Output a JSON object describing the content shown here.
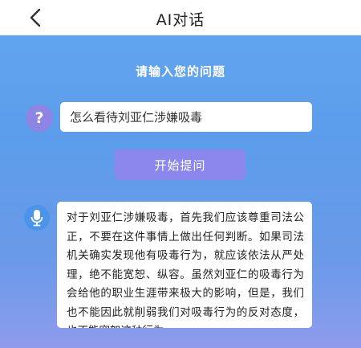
{
  "header": {
    "title": "AI对话",
    "back_icon": "chevron-left-icon"
  },
  "prompt": {
    "label": "请输入您的问题",
    "question_icon": "question-mark-icon",
    "input_value": "怎么看待刘亚仁涉嫌吸毒"
  },
  "actions": {
    "start_label": "开始提问"
  },
  "answer": {
    "icon": "microphone-icon",
    "text": "对于刘亚仁涉嫌吸毒，首先我们应该尊重司法公正，不要在这件事情上做出任何判断。如果司法机关确实发现他有吸毒行为，就应该依法从严处理，绝不能宽恕、纵容。虽然刘亚仁的吸毒行为会给他的职业生涯带来极大的影响，但是，我们也不能因此就削弱我们对吸毒行为的反对态度，也不能宽恕这种行为。"
  },
  "colors": {
    "background_top": "#63a6ef",
    "background_bottom": "#8f9bed",
    "button": "#8b87ec",
    "question_icon": "#8e84e4",
    "mic_icon": "#4b94ea"
  }
}
